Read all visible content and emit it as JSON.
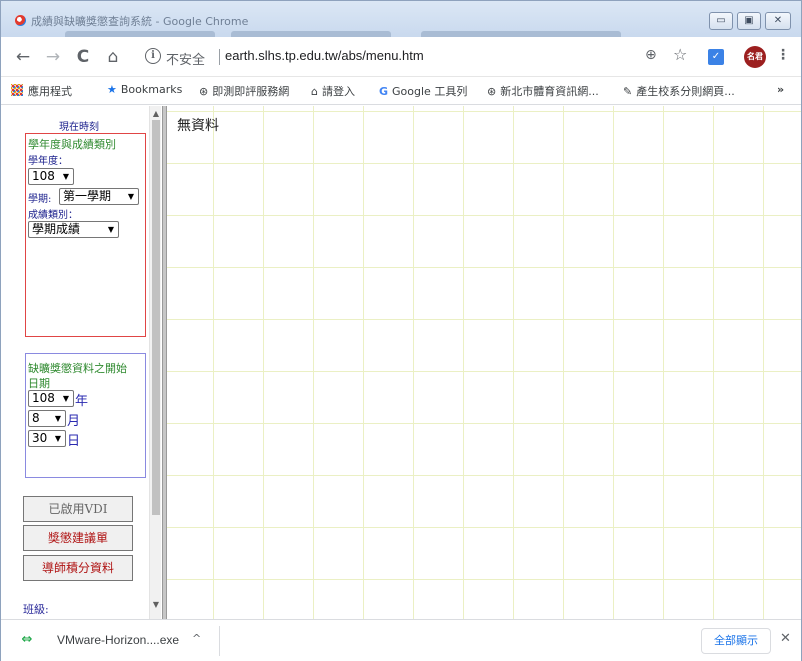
{
  "window": {
    "title": "成績與缺曠獎懲查詢系統 - Google Chrome",
    "controls": {
      "minimize": "▭",
      "maximize": "▣",
      "close": "✕"
    }
  },
  "toolbar": {
    "back": "←",
    "forward": "→",
    "reload": "C",
    "home": "⌂",
    "security_label": "不安全",
    "url": "earth.slhs.tp.edu.tw/abs/menu.htm",
    "zoom_icon": "⊕",
    "star_icon": "☆",
    "avatar_label": "名君",
    "menu_icon": "⋮"
  },
  "bookmarks": {
    "items": [
      {
        "label": "應用程式",
        "icon": "apps-icon"
      },
      {
        "label": "Bookmarks",
        "icon": "star-icon"
      },
      {
        "label": "即測即評服務網",
        "icon": "globe-icon"
      },
      {
        "label": "請登入",
        "icon": "home-icon"
      },
      {
        "label": "Google 工具列",
        "icon": "google-icon"
      },
      {
        "label": "新北市體育資訊網...",
        "icon": "globe-icon"
      },
      {
        "label": "產生校系分則網頁...",
        "icon": "brush-icon"
      }
    ],
    "more": "»"
  },
  "sidebar": {
    "current_time_label": "現在時刻",
    "grades": {
      "header": "學年度與成績類別",
      "year_label": "學年度：",
      "year_value": "108",
      "semester_label": "學期:",
      "semester_value": "第一學期",
      "category_label": "成績類別：",
      "category_value": "學期成績"
    },
    "attendance": {
      "header_line1": "缺曠獎懲資料之開始",
      "header_line2": "日期",
      "year_value": "108",
      "year_unit": "年",
      "month_value": "8",
      "month_unit": "月",
      "day_value": "30",
      "day_unit": "日"
    },
    "buttons": {
      "vdi": "已啟用VDI",
      "reward_suggestion": "獎懲建議單",
      "mentor_points": "導師積分資料"
    },
    "class_label": "班級:"
  },
  "main": {
    "no_data": "無資料"
  },
  "downloads": {
    "file_name": "VMware-Horizon....exe",
    "caret": "^",
    "show_all": "全部顯示",
    "close": "✕"
  },
  "colors": {
    "grid": "#ebf0c4",
    "red_border": "#e04545",
    "blue_border": "#8a8ae0",
    "label_blue": "#1a1f8c",
    "label_green": "#2f8a2f",
    "download_green": "#20a84a"
  }
}
